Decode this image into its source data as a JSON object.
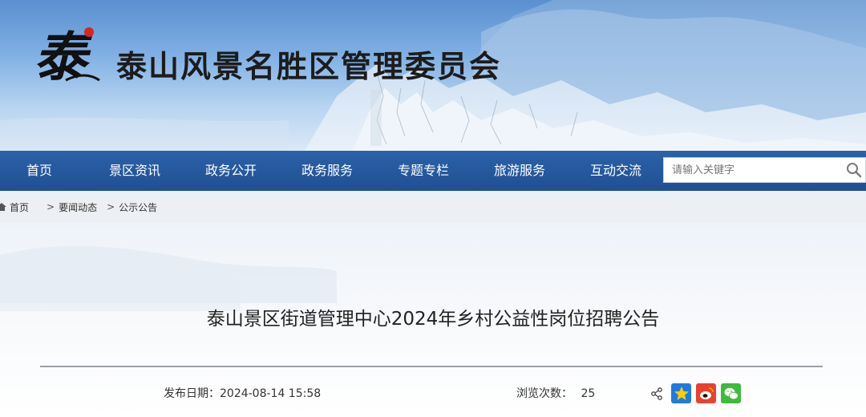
{
  "header": {
    "logo_char": "泰",
    "site_title": "泰山风景名胜区管理委员会"
  },
  "nav": {
    "items": [
      {
        "label": "首页"
      },
      {
        "label": "景区资讯"
      },
      {
        "label": "政务公开"
      },
      {
        "label": "政务服务"
      },
      {
        "label": "专题专栏"
      },
      {
        "label": "旅游服务"
      },
      {
        "label": "互动交流"
      }
    ],
    "search_placeholder": "请输入关键字"
  },
  "breadcrumb": {
    "items": [
      "首页",
      "要闻动态",
      "公示公告"
    ],
    "separator": ">"
  },
  "article": {
    "title": "泰山景区街道管理中心2024年乡村公益性岗位招聘公告",
    "date_label": "发布日期：2024-08-14 15:58",
    "views_label": "浏览次数：",
    "views_count": "25"
  },
  "colors": {
    "nav_bg": "#1f4f93",
    "breadcrumb_bg": "#eceff3",
    "logo_red": "#d9261c"
  },
  "icons": {
    "search": "search-icon",
    "home": "home-icon",
    "share": "share-icon",
    "qzone": "qzone-star-icon",
    "weibo": "weibo-icon",
    "wechat": "wechat-icon"
  }
}
